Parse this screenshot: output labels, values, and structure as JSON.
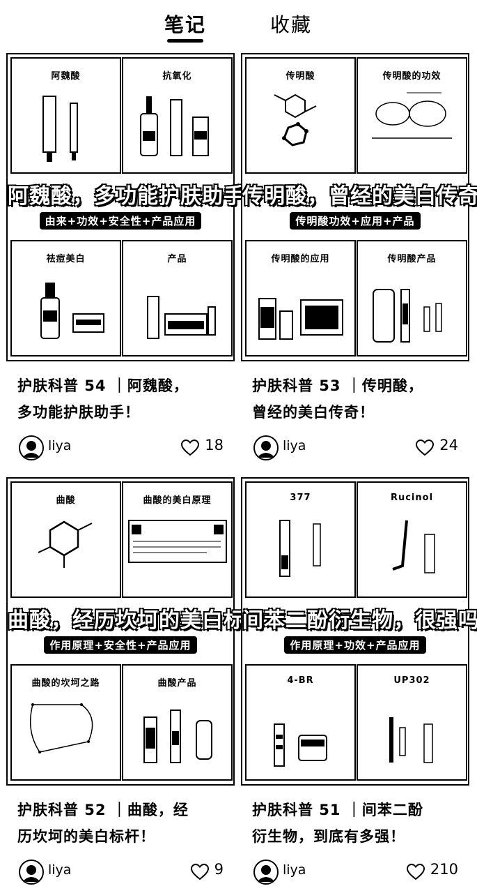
{
  "tabs": [
    {
      "label": "笔记",
      "active": true
    },
    {
      "label": "收藏",
      "active": false
    }
  ],
  "cards": [
    {
      "panels": [
        {
          "title": "阿魏酸"
        },
        {
          "title": "抗氧化"
        },
        {
          "title": "祛痘美白"
        },
        {
          "title": "产品"
        }
      ],
      "headline": "阿魏酸，多功能护肤助手",
      "subline": "由来+功效+安全性+产品应用",
      "caption_line1": "护肤科普 54 ｜阿魏酸，",
      "caption_line2": "多功能护肤助手！",
      "author": "liya",
      "likes": "18"
    },
    {
      "panels": [
        {
          "title": "传明酸"
        },
        {
          "title": "传明酸的功效"
        },
        {
          "title": "传明酸的应用"
        },
        {
          "title": "传明酸产品"
        }
      ],
      "headline": "传明酸，曾经的美白传奇",
      "subline": "传明酸功效+应用+产品",
      "caption_line1": "护肤科普 53 ｜传明酸，",
      "caption_line2": "曾经的美白传奇！",
      "author": "liya",
      "likes": "24"
    },
    {
      "panels": [
        {
          "title": "曲酸"
        },
        {
          "title": "曲酸的美白原理"
        },
        {
          "title": "曲酸的坎坷之路"
        },
        {
          "title": "曲酸产品"
        }
      ],
      "headline": "曲酸，经历坎坷的美白标杆",
      "subline": "作用原理+安全性+产品应用",
      "caption_line1": "护肤科普 52 ｜曲酸，经",
      "caption_line2": "历坎坷的美白标杆！",
      "author": "liya",
      "likes": "9"
    },
    {
      "panels": [
        {
          "title": "377"
        },
        {
          "title": "Rucinol"
        },
        {
          "title": "4-BR"
        },
        {
          "title": "UP302"
        }
      ],
      "headline": "间苯二酚衍生物，很强吗",
      "subline": "作用原理+功效+产品应用",
      "caption_line1": "护肤科普 51 ｜间苯二酚",
      "caption_line2": "衍生物，到底有多强！",
      "author": "liya",
      "likes": "210"
    }
  ]
}
